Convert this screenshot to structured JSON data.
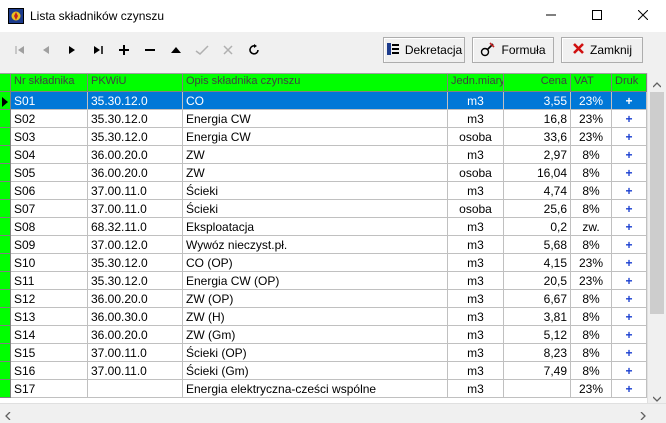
{
  "window": {
    "title": "Lista składników czynszu"
  },
  "buttons": {
    "dekretacja": "Dekretacja",
    "formula": "Formuła",
    "zamknij": "Zamknij"
  },
  "columns": [
    "Nr składnika",
    "PKWiU",
    "Opis składnika czynszu",
    "Jedn.miary",
    "Cena",
    "VAT",
    "Druk"
  ],
  "rows": [
    {
      "nr": "S01",
      "pkwiu": "35.30.12.0",
      "opis": "CO",
      "jm": "m3",
      "cena": "3,55",
      "vat": "23%",
      "druk": "+"
    },
    {
      "nr": "S02",
      "pkwiu": "35.30.12.0",
      "opis": "Energia CW",
      "jm": "m3",
      "cena": "16,8",
      "vat": "23%",
      "druk": "+"
    },
    {
      "nr": "S03",
      "pkwiu": "35.30.12.0",
      "opis": "Energia CW",
      "jm": "osoba",
      "cena": "33,6",
      "vat": "23%",
      "druk": "+"
    },
    {
      "nr": "S04",
      "pkwiu": "36.00.20.0",
      "opis": "ZW",
      "jm": "m3",
      "cena": "2,97",
      "vat": "8%",
      "druk": "+"
    },
    {
      "nr": "S05",
      "pkwiu": "36.00.20.0",
      "opis": "ZW",
      "jm": "osoba",
      "cena": "16,04",
      "vat": "8%",
      "druk": "+"
    },
    {
      "nr": "S06",
      "pkwiu": "37.00.11.0",
      "opis": "Ścieki",
      "jm": "m3",
      "cena": "4,74",
      "vat": "8%",
      "druk": "+"
    },
    {
      "nr": "S07",
      "pkwiu": "37.00.11.0",
      "opis": "Ścieki",
      "jm": "osoba",
      "cena": "25,6",
      "vat": "8%",
      "druk": "+"
    },
    {
      "nr": "S08",
      "pkwiu": "68.32.11.0",
      "opis": "Eksploatacja",
      "jm": "m3",
      "cena": "0,2",
      "vat": "zw.",
      "druk": "+"
    },
    {
      "nr": "S09",
      "pkwiu": "37.00.12.0",
      "opis": "Wywóz nieczyst.pł.",
      "jm": "m3",
      "cena": "5,68",
      "vat": "8%",
      "druk": "+"
    },
    {
      "nr": "S10",
      "pkwiu": "35.30.12.0",
      "opis": "CO (OP)",
      "jm": "m3",
      "cena": "4,15",
      "vat": "23%",
      "druk": "+"
    },
    {
      "nr": "S11",
      "pkwiu": "35.30.12.0",
      "opis": "Energia CW (OP)",
      "jm": "m3",
      "cena": "20,5",
      "vat": "23%",
      "druk": "+"
    },
    {
      "nr": "S12",
      "pkwiu": "36.00.20.0",
      "opis": "ZW (OP)",
      "jm": "m3",
      "cena": "6,67",
      "vat": "8%",
      "druk": "+"
    },
    {
      "nr": "S13",
      "pkwiu": "36.00.30.0",
      "opis": "ZW (H)",
      "jm": "m3",
      "cena": "3,81",
      "vat": "8%",
      "druk": "+"
    },
    {
      "nr": "S14",
      "pkwiu": "36.00.20.0",
      "opis": "ZW (Gm)",
      "jm": "m3",
      "cena": "5,12",
      "vat": "8%",
      "druk": "+"
    },
    {
      "nr": "S15",
      "pkwiu": "37.00.11.0",
      "opis": "Ścieki (OP)",
      "jm": "m3",
      "cena": "8,23",
      "vat": "8%",
      "druk": "+"
    },
    {
      "nr": "S16",
      "pkwiu": "37.00.11.0",
      "opis": "Ścieki (Gm)",
      "jm": "m3",
      "cena": "7,49",
      "vat": "8%",
      "druk": "+"
    },
    {
      "nr": "S17",
      "pkwiu": "",
      "opis": "Energia elektryczna-cześci wspólne",
      "jm": "m3",
      "cena": "",
      "vat": "23%",
      "druk": "+"
    }
  ],
  "icons": [
    "window-app-icon",
    "minimize-icon",
    "maximize-icon",
    "close-icon",
    "first-record-icon",
    "prior-record-icon",
    "next-record-icon",
    "last-record-icon",
    "insert-icon",
    "delete-icon",
    "edit-icon",
    "post-icon",
    "cancel-icon",
    "refresh-icon",
    "dekretacja-icon",
    "formula-icon",
    "zamknij-icon",
    "row-indicator-icon"
  ],
  "colors": {
    "header_bg": "#00ff00",
    "selection": "#0078d7",
    "druk_plus": "#1a3fd0",
    "zamknij_x": "#d01010"
  }
}
